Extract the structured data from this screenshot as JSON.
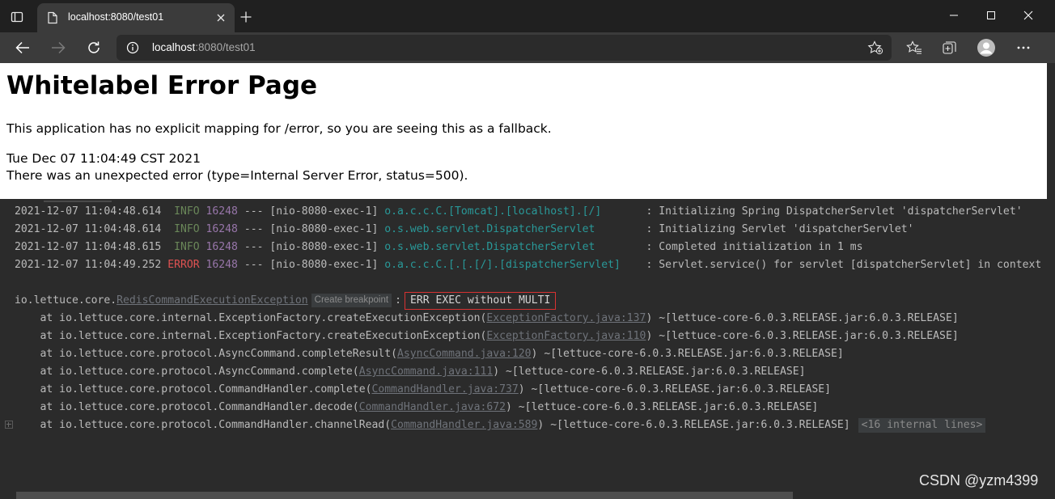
{
  "browser": {
    "tab_title": "localhost:8080/test01",
    "url_host": "localhost",
    "url_path": ":8080/test01"
  },
  "page": {
    "heading": "Whitelabel Error Page",
    "message": "This application has no explicit mapping for /error, so you are seeing this as a fallback.",
    "timestamp": "Tue Dec 07 11:04:49 CST 2021",
    "error_line": "There was an unexpected error (type=Internal Server Error, status=500)."
  },
  "console": {
    "log_lines": [
      {
        "time": "2021-12-07 11:04:48.614",
        "level": " INFO",
        "pid": "16248",
        "sep": " --- ",
        "thread": "[nio-8080-exec-1]",
        "logger": "o.a.c.c.C.[Tomcat].[localhost].[/]      ",
        "message": " : Initializing Spring DispatcherServlet 'dispatcherServlet'"
      },
      {
        "time": "2021-12-07 11:04:48.614",
        "level": " INFO",
        "pid": "16248",
        "sep": " --- ",
        "thread": "[nio-8080-exec-1]",
        "logger": "o.s.web.servlet.DispatcherServlet       ",
        "message": " : Initializing Servlet 'dispatcherServlet'"
      },
      {
        "time": "2021-12-07 11:04:48.615",
        "level": " INFO",
        "pid": "16248",
        "sep": " --- ",
        "thread": "[nio-8080-exec-1]",
        "logger": "o.s.web.servlet.DispatcherServlet       ",
        "message": " : Completed initialization in 1 ms"
      },
      {
        "time": "2021-12-07 11:04:49.252",
        "level": "ERROR",
        "pid": "16248",
        "sep": " --- ",
        "thread": "[nio-8080-exec-1]",
        "logger": "o.a.c.c.C.[.[.[/].[dispatcherServlet]   ",
        "message": " : Servlet.service() for servlet [dispatcherServlet] in context"
      }
    ],
    "exception": {
      "package": "io.lettuce.core.",
      "class": "RedisCommandExecutionException",
      "breakpoint_hint": "Create breakpoint",
      "separator": ":",
      "message": "ERR EXEC without MULTI"
    },
    "stack": [
      {
        "prefix": "    at io.lettuce.core.internal.ExceptionFactory.createExecutionException(",
        "link": "ExceptionFactory.java:137",
        "suffix": ") ~[lettuce-core-6.0.3.RELEASE.jar:6.0.3.RELEASE]"
      },
      {
        "prefix": "    at io.lettuce.core.internal.ExceptionFactory.createExecutionException(",
        "link": "ExceptionFactory.java:110",
        "suffix": ") ~[lettuce-core-6.0.3.RELEASE.jar:6.0.3.RELEASE]"
      },
      {
        "prefix": "    at io.lettuce.core.protocol.AsyncCommand.completeResult(",
        "link": "AsyncCommand.java:120",
        "suffix": ") ~[lettuce-core-6.0.3.RELEASE.jar:6.0.3.RELEASE]"
      },
      {
        "prefix": "    at io.lettuce.core.protocol.AsyncCommand.complete(",
        "link": "AsyncCommand.java:111",
        "suffix": ") ~[lettuce-core-6.0.3.RELEASE.jar:6.0.3.RELEASE]"
      },
      {
        "prefix": "    at io.lettuce.core.protocol.CommandHandler.complete(",
        "link": "CommandHandler.java:737",
        "suffix": ") ~[lettuce-core-6.0.3.RELEASE.jar:6.0.3.RELEASE]"
      },
      {
        "prefix": "    at io.lettuce.core.protocol.CommandHandler.decode(",
        "link": "CommandHandler.java:672",
        "suffix": ") ~[lettuce-core-6.0.3.RELEASE.jar:6.0.3.RELEASE]"
      },
      {
        "prefix": "    at io.lettuce.core.protocol.CommandHandler.channelRead(",
        "link": "CommandHandler.java:589",
        "suffix": ") ~[lettuce-core-6.0.3.RELEASE.jar:6.0.3.RELEASE]"
      }
    ],
    "internal_lines": "<16 internal lines>"
  },
  "watermark": "CSDN @yzm4399",
  "colors": {
    "info": "#6a8759",
    "error": "#e05252",
    "pid": "#9876aa",
    "logger": "#299999",
    "error_box": "#d83232"
  },
  "icons": {
    "tab_actions": "tab-actions-icon",
    "page": "page-icon",
    "close": "close-icon",
    "new_tab": "plus-icon",
    "minimize": "minimize-icon",
    "maximize": "maximize-icon",
    "window_close": "window-close-icon",
    "back": "back-arrow-icon",
    "forward": "forward-arrow-icon",
    "refresh": "refresh-icon",
    "info": "info-icon",
    "add_favorite": "star-plus-icon",
    "favorites": "favorites-icon",
    "collections": "collections-icon",
    "profile": "profile-avatar-icon",
    "more": "more-dots-icon"
  }
}
